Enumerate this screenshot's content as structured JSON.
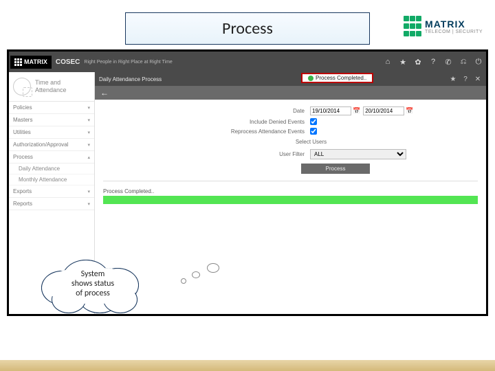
{
  "slide": {
    "title": "Process"
  },
  "brand": {
    "name": "MATRIX",
    "sub": "TELECOM | SECURITY"
  },
  "app": {
    "logo": "MATRIX",
    "product": "COSEC",
    "tagline": "Right People in Right Place at Right Time",
    "header_icons": [
      "⌂",
      "★",
      "✿",
      "?",
      "✆",
      "⎌",
      "⏻"
    ]
  },
  "sidebar": {
    "module": "Time and\nAttendance",
    "groups": [
      "Policies",
      "Masters",
      "Utilities",
      "Authorization/Approval",
      "Process"
    ],
    "process_sub": [
      "Daily Attendance",
      "Monthly Attendance"
    ],
    "tail": [
      "Exports",
      "Reports"
    ]
  },
  "crumb": {
    "title": "Daily Attendance Process",
    "status": "Process Completed..",
    "right_icons": [
      "★",
      "?",
      "✕"
    ]
  },
  "form": {
    "date_label": "Date",
    "date_from": "19/10/2014",
    "date_to": "20/10/2014",
    "include_label": "Include Denied Events",
    "include_checked": true,
    "reprocess_label": "Reprocess Attendance Events",
    "reprocess_checked": true,
    "select_users_label": "Select Users",
    "user_filter_label": "User Filter",
    "user_filter_value": "ALL",
    "process_btn": "Process",
    "result_label": "Process Completed.."
  },
  "callout": {
    "text1": "System",
    "text2": "shows status",
    "text3": "of process"
  }
}
